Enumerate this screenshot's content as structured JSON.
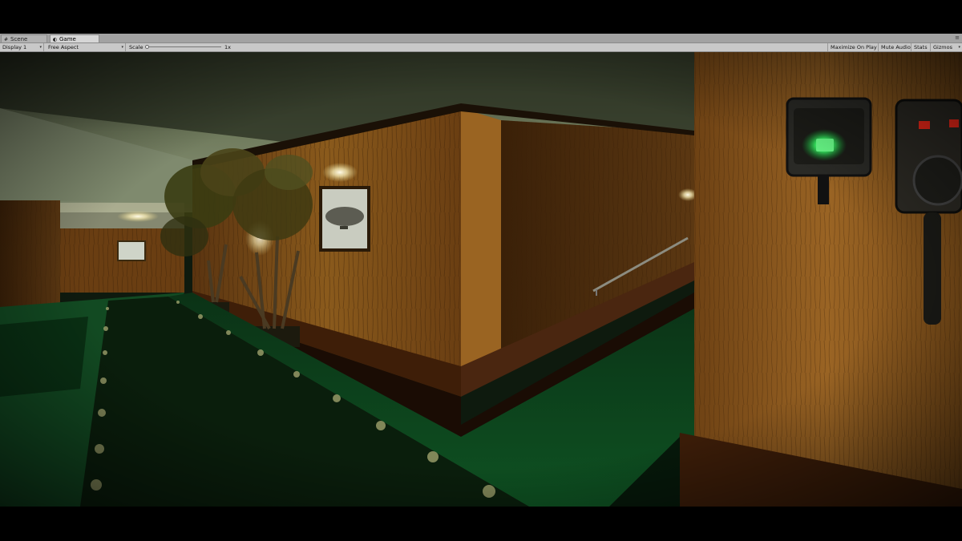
{
  "tabs": [
    {
      "label": "Scene",
      "icon": "scene-grid-icon",
      "active": false
    },
    {
      "label": "Game",
      "icon": "game-pacman-icon",
      "active": true
    }
  ],
  "toolbar": {
    "display": "Display 1",
    "aspect": "Free Aspect",
    "scale_label": "Scale",
    "scale_value": "1x",
    "maximize": "Maximize On Play",
    "mute": "Mute Audio",
    "stats": "Stats",
    "gizmos": "Gizmos"
  },
  "colors": {
    "wood": "#7a4a14",
    "carpet": "#0c2a12",
    "floor": "#0d4a1e",
    "ceiling": "#7f8a6e",
    "device_light": "#3cff6a",
    "device_red": "#ff2a1a"
  }
}
